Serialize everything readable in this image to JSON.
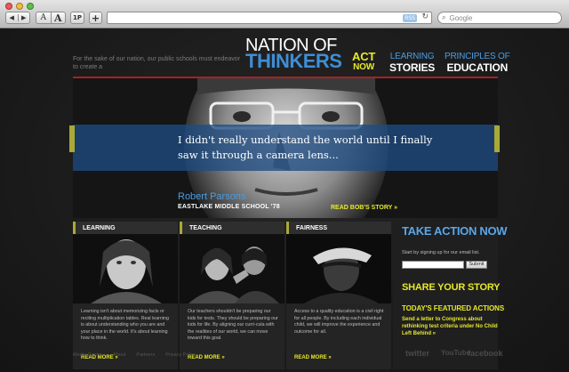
{
  "browser": {
    "nav_back": "◀",
    "nav_forward": "▶",
    "text_small": "A",
    "text_large": "A",
    "one_p": "1P",
    "add": "+",
    "rss": "RSS",
    "search_placeholder": "Google"
  },
  "site": {
    "tagline": "For the sake of our nation, our public schools must endeavor to create a",
    "logo_line1": "NATION OF",
    "logo_line2": "THINKERS",
    "nav": [
      {
        "line1": "ACT",
        "line2": "NOW"
      },
      {
        "line1": "LEARNING",
        "line2": "STORIES"
      },
      {
        "line1": "PRINCIPLES OF",
        "line2": "EDUCATION"
      }
    ]
  },
  "hero": {
    "quote": "I didn't really understand the world until I finally saw it through a camera lens...",
    "name": "Robert Parsons",
    "school": "EASTLAKE MIDDLE SCHOOL '78",
    "link": "READ BOB'S STORY »"
  },
  "columns": [
    {
      "title": "LEARNING",
      "text": "Learning isn't about memorizing facts or reciting multiplication tables.  Real learning is about understanding who you are and your place in the world.  It's about learning how to think.",
      "more": "READ MORE »"
    },
    {
      "title": "TEACHING",
      "text": "Our teachers shouldn't be preparing our kids for tests.  They should be preparing our kids for life.  By aligning our curri-cula with the realities of our world, we can move toward this goal.",
      "more": "READ MORE »"
    },
    {
      "title": "FAIRNESS",
      "text": "Access to a quality education is a civil right for all people.  By including each individual child, we will improve the experience and outcome for all.",
      "more": "READ MORE »"
    }
  ],
  "sidebar": {
    "take_action": "TAKE ACTION NOW",
    "signup": "Start by signing up for our email list.",
    "submit": "Submit",
    "share": "SHARE YOUR STORY",
    "featured": "TODAY'S FEATURED ACTIONS",
    "featured_link": "Send a letter to Congress about rethinking test criteria under No Child Left Behind »"
  },
  "footer": {
    "links": [
      "Media Center",
      "About",
      "Partners",
      "Privacy Policy"
    ],
    "twitter": "twitter",
    "youtube": "YouTube",
    "facebook": "facebook"
  }
}
